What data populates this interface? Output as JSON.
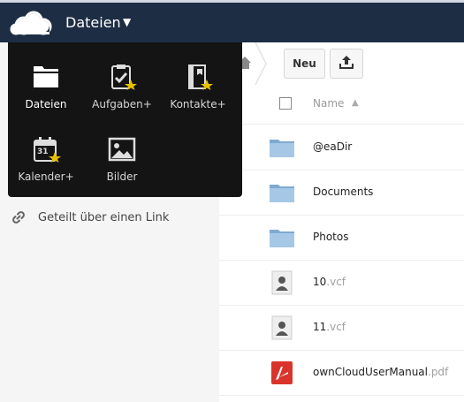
{
  "header": {
    "app_name": "Dateien",
    "caret": "▼",
    "logo_icon": "owncloud-cloud-logo"
  },
  "app_menu": {
    "items": [
      {
        "label": "Dateien",
        "icon": "folder-icon"
      },
      {
        "label": "Aufgaben+",
        "icon": "tasks-clipboard-icon"
      },
      {
        "label": "Kontakte+",
        "icon": "contacts-book-icon"
      },
      {
        "label": "Kalender+",
        "icon": "calendar-icon",
        "calendar_day": "31"
      },
      {
        "label": "Bilder",
        "icon": "pictures-icon"
      }
    ]
  },
  "sidebar": {
    "items": [
      {
        "label": "Geteilt über einen Link",
        "icon": "link-icon"
      }
    ]
  },
  "controls": {
    "new_label": "Neu",
    "upload_icon": "upload-icon",
    "home_icon": "home-icon"
  },
  "file_list": {
    "column_name": "Name",
    "sort_indicator": "▲",
    "rows": [
      {
        "name": "@eaDir",
        "ext": "",
        "icon": "folder-icon"
      },
      {
        "name": "Documents",
        "ext": "",
        "icon": "folder-icon"
      },
      {
        "name": "Photos",
        "ext": "",
        "icon": "folder-icon"
      },
      {
        "name": "10",
        "ext": ".vcf",
        "icon": "contact-file-icon"
      },
      {
        "name": "11",
        "ext": ".vcf",
        "icon": "contact-file-icon"
      },
      {
        "name": "ownCloudUserManual",
        "ext": ".pdf",
        "icon": "pdf-file-icon"
      }
    ]
  },
  "colors": {
    "header_bg": "#1d2d44",
    "menu_bg": "#0a0a0a",
    "sidebar_bg": "#f5f5f5",
    "star": "#e5c000",
    "folder": "#8fb6d8"
  }
}
